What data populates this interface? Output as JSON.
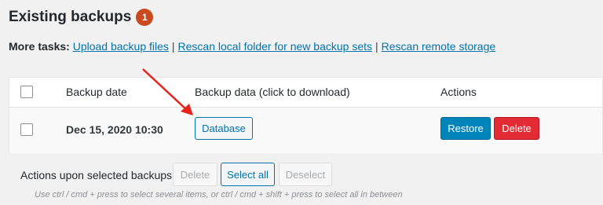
{
  "header": {
    "title": "Existing backups",
    "count": "1"
  },
  "more_tasks": {
    "label": "More tasks:",
    "links": [
      "Upload backup files",
      "Rescan local folder for new backup sets",
      "Rescan remote storage"
    ],
    "separator": "|"
  },
  "table": {
    "columns": [
      "Backup date",
      "Backup data (click to download)",
      "Actions"
    ],
    "rows": [
      {
        "date": "Dec 15, 2020 10:30",
        "data_button": "Database",
        "restore_label": "Restore",
        "delete_label": "Delete"
      }
    ]
  },
  "bulk_actions": {
    "label": "Actions upon selected backups",
    "delete_label": "Delete",
    "select_all_label": "Select all",
    "deselect_label": "Deselect",
    "hint": "Use ctrl / cmd + press to select several items, or ctrl / cmd + shift + press to select all in between"
  },
  "colors": {
    "link": "#0073aa",
    "badge": "#ca4a1f",
    "restore": "#0085ba",
    "delete": "#e22b34",
    "annotation_arrow": "#e8231c"
  },
  "icons": [
    "checkbox",
    "arrow-annotation"
  ]
}
